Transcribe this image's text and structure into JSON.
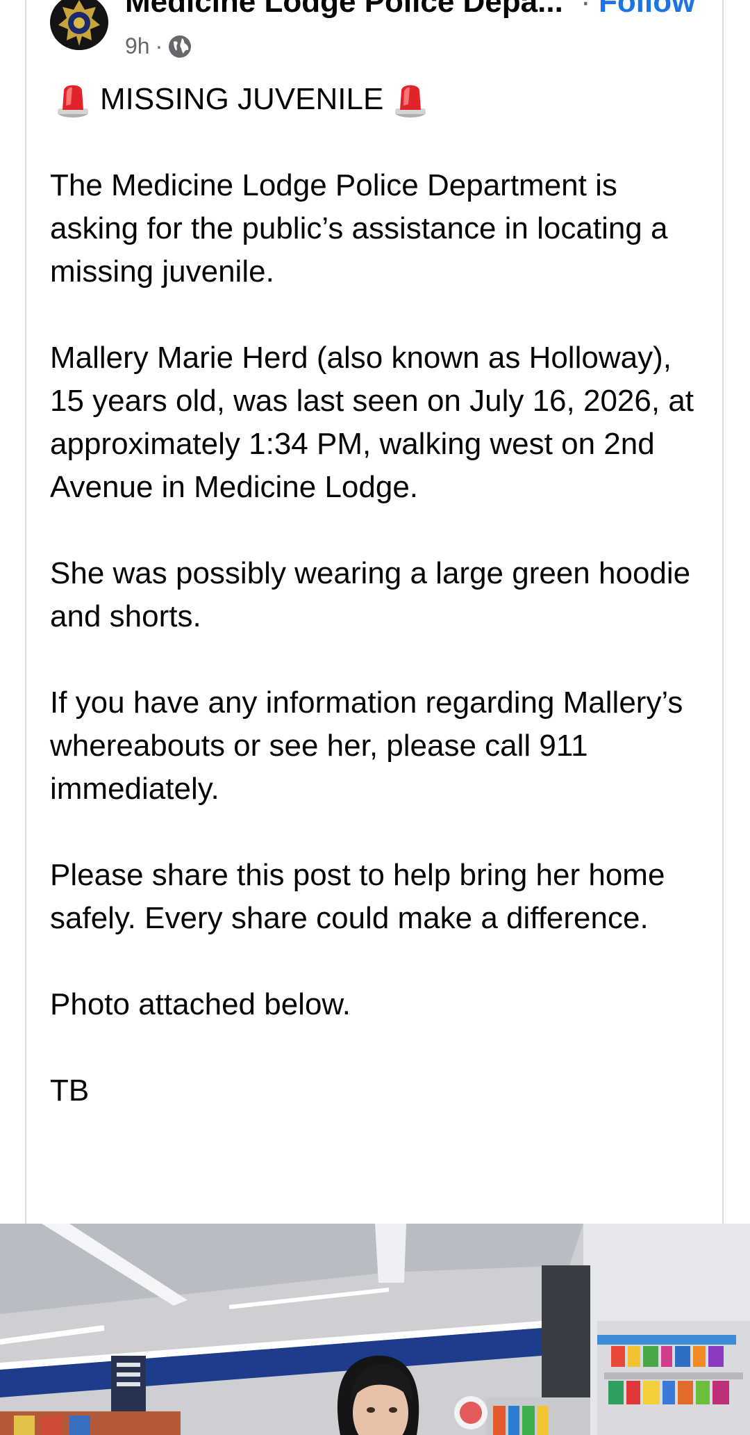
{
  "post": {
    "page_name": "Medicine Lodge Police Depa...",
    "follow_separator": "·",
    "follow_label": "Follow",
    "time": "9h",
    "meta_separator": "·",
    "audience_icon": "globe-icon",
    "headline_icon": "police-siren-icon",
    "headline": "MISSING JUVENILE",
    "paragraphs": [
      "The Medicine Lodge Police Department is asking for the public’s assistance in locating a missing juvenile.",
      "Mallery Marie Herd (also known as Holloway), 15 years old, was last seen on July 16, 2026, at approximately 1:34 PM, walking west on 2nd Avenue in Medicine Lodge.",
      "She was possibly wearing a large green hoodie and shorts.",
      "If you have any information regarding Mallery’s whereabouts or see her, please call 911 immediately.",
      "Please share this post to help bring her home safely. Every share could make a difference.",
      "Photo attached below.",
      "TB"
    ]
  },
  "colors": {
    "follow_blue": "#1b74e4",
    "meta_gray": "#65676b",
    "border_gray": "#dadde1",
    "siren_red": "#e0242a"
  }
}
